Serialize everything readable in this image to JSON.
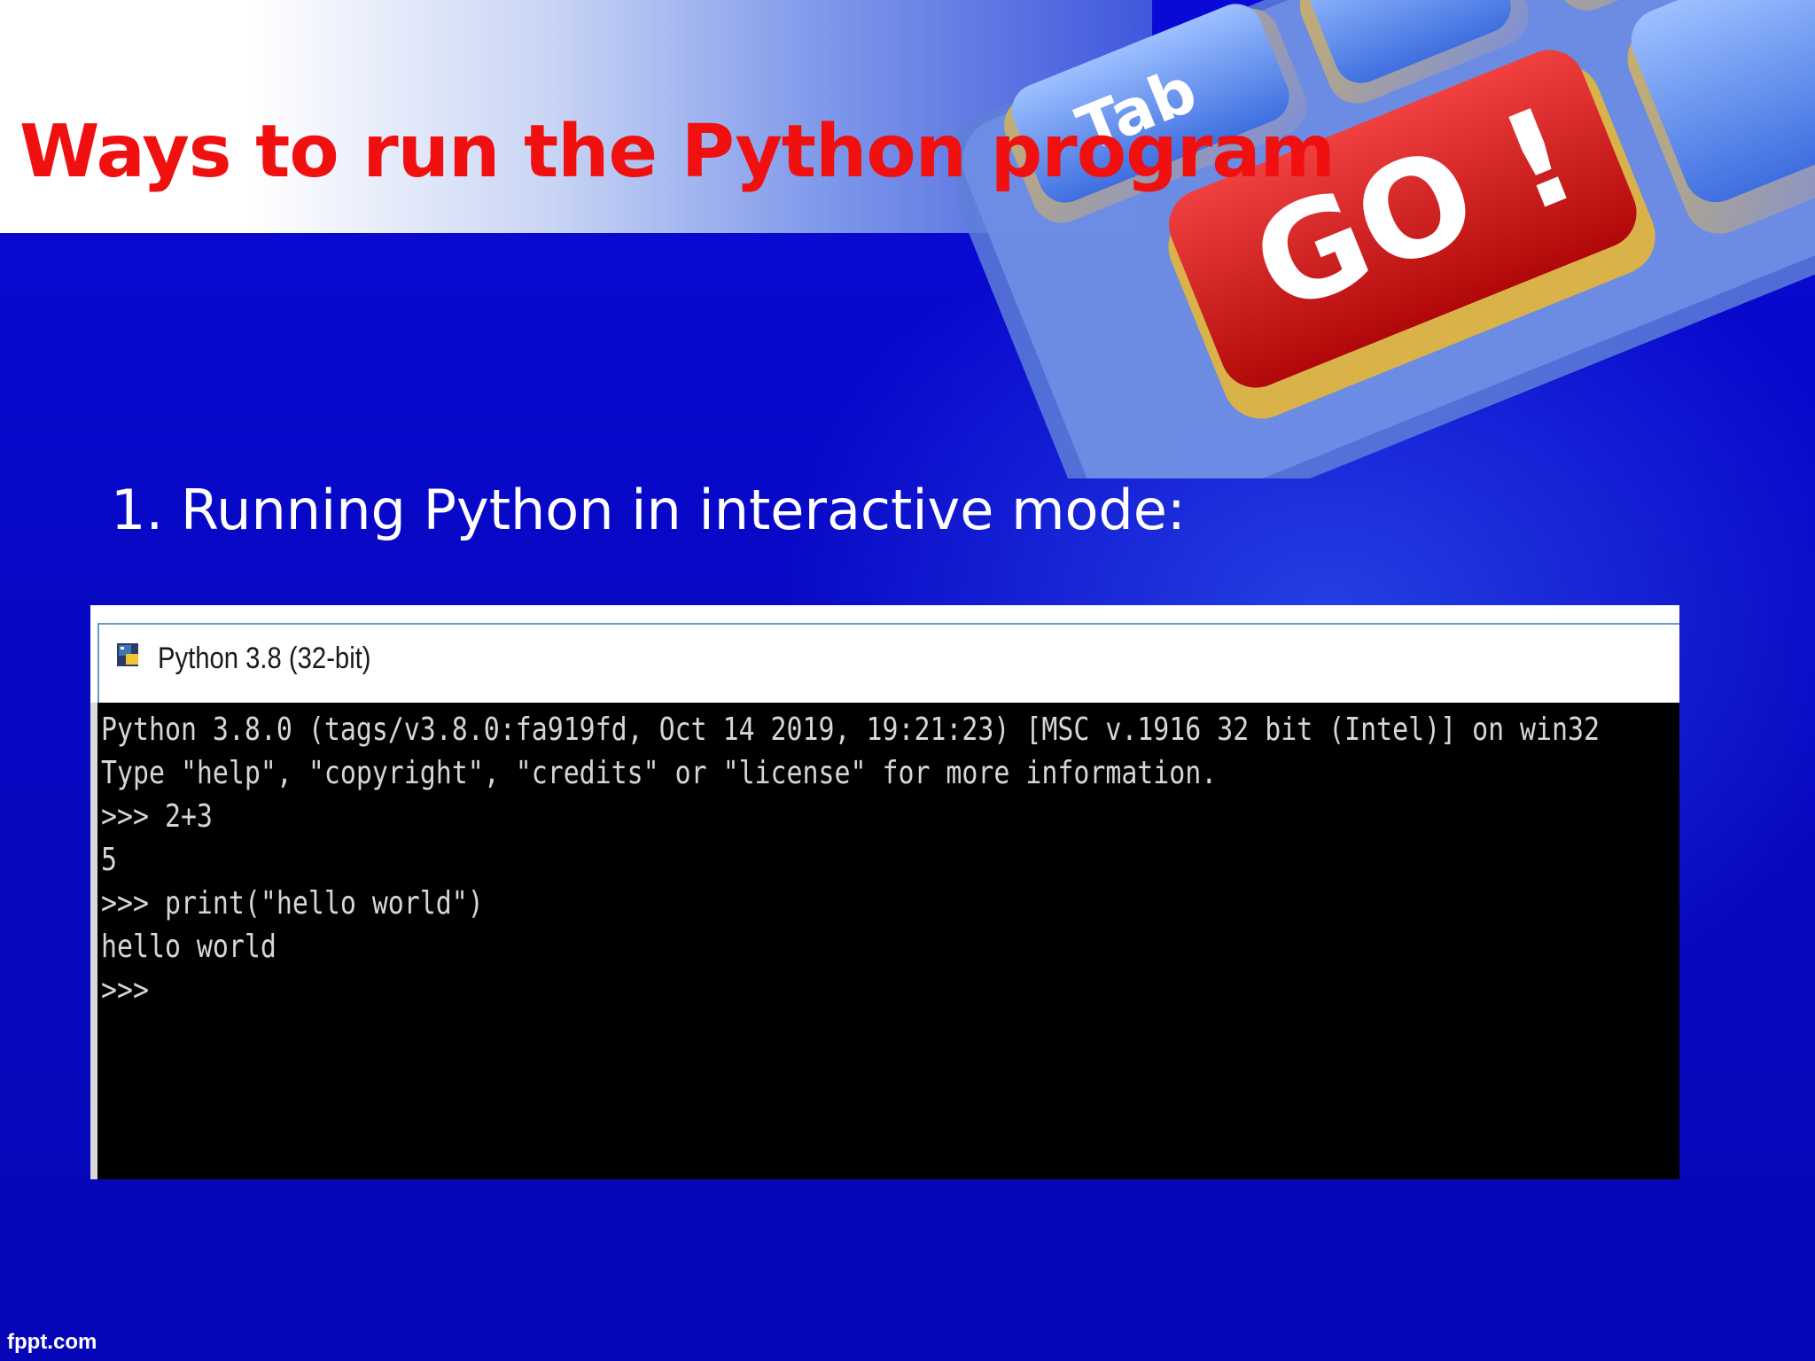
{
  "slide": {
    "title": "Ways to run the Python program",
    "bullet": "1. Running Python in interactive mode:",
    "footer_brand": "fppt.com"
  },
  "decoration": {
    "key_labels": [
      "Tab",
      "GO !"
    ],
    "go_key_color": "#d81818"
  },
  "console": {
    "window_title": "Python 3.8 (32-bit)",
    "icon": "python-icon",
    "lines": [
      "Python 3.8.0 (tags/v3.8.0:fa919fd, Oct 14 2019, 19:21:23) [MSC v.1916 32 bit (Intel)] on win32",
      "Type \"help\", \"copyright\", \"credits\" or \"license\" for more information.",
      ">>> 2+3",
      "5",
      ">>> print(\"hello world\")",
      "hello world",
      ">>>"
    ]
  },
  "colors": {
    "title": "#f01010",
    "background": "#0a0ac8",
    "console_bg": "#000000",
    "console_text": "#d6d6d6"
  }
}
